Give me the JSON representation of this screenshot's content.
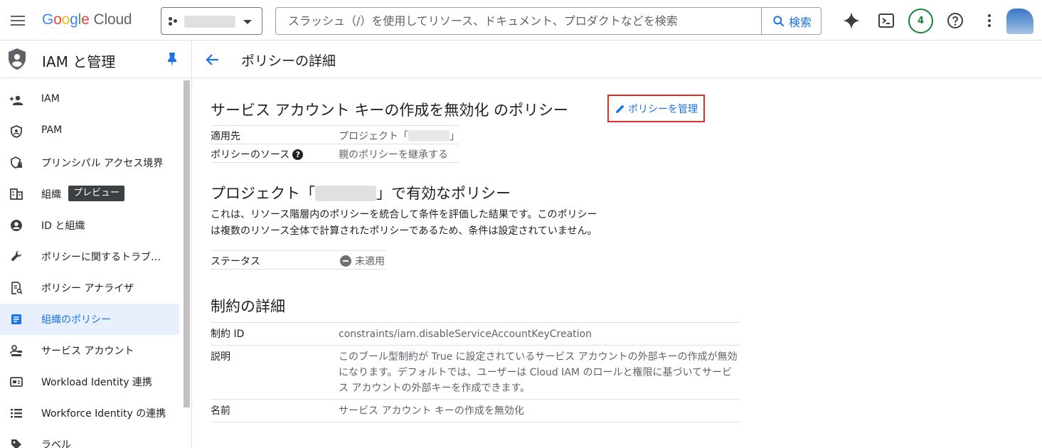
{
  "topbar": {
    "logo": {
      "google": "Google",
      "cloud": "Cloud"
    },
    "search_placeholder": "スラッシュ（/）を使用してリソース、ドキュメント、プロダクトなどを検索",
    "search_button": "検索",
    "notifications_count": "4",
    "icons": [
      "menu-icon",
      "project-icon",
      "search-icon",
      "gemini-sparkle-icon",
      "cloud-shell-icon",
      "help-icon",
      "more-vert-icon",
      "avatar"
    ]
  },
  "sidebar": {
    "title": "IAM と管理",
    "items": [
      {
        "label": "IAM",
        "icon": "person-add-icon"
      },
      {
        "label": "PAM",
        "icon": "shield-icon"
      },
      {
        "label": "プリンシパル アクセス境界",
        "icon": "lock-shield-icon"
      },
      {
        "label": "組織",
        "icon": "building-icon",
        "chip": "プレビュー"
      },
      {
        "label": "ID と組織",
        "icon": "account-circle-icon"
      },
      {
        "label": "ポリシーに関するトラブ…",
        "icon": "wrench-icon"
      },
      {
        "label": "ポリシー アナライザ",
        "icon": "analyzer-icon"
      },
      {
        "label": "組織のポリシー",
        "icon": "document-icon",
        "active": true
      },
      {
        "label": "サービス アカウント",
        "icon": "service-account-icon"
      },
      {
        "label": "Workload Identity 連携",
        "icon": "id-card-icon"
      },
      {
        "label": "Workforce Identity の連携",
        "icon": "list-icon"
      },
      {
        "label": "ラベル",
        "icon": "label-icon"
      }
    ]
  },
  "page": {
    "title": "ポリシーの詳細",
    "policy_title": "サービス アカウント キーの作成を無効化 のポリシー",
    "manage_button": "ポリシーを管理",
    "info": {
      "applies_to_label": "適用先",
      "applies_to_prefix": "プロジェクト「",
      "applies_to_suffix": "」",
      "source_label": "ポリシーのソース",
      "source_value": "親のポリシーを継承する"
    },
    "effective": {
      "heading_prefix": "プロジェクト「",
      "heading_suffix": "」で有効なポリシー",
      "desc_line1": "これは、リソース階層内のポリシーを統合して条件を評価した結果です。このポリシー",
      "desc_line2": "は複数のリソース全体で計算されたポリシーであるため、条件は設定されていません。",
      "status_label": "ステータス",
      "status_value": "未適用"
    },
    "constraint": {
      "heading": "制約の詳細",
      "rows": [
        {
          "label": "制約 ID",
          "value": "constraints/iam.disableServiceAccountKeyCreation"
        },
        {
          "label": "説明",
          "value": "このブール型制約が True に設定されているサービス アカウントの外部キーの作成が無効になります。デフォルトでは、ユーザーは Cloud IAM のロールと権限に基づいてサービス アカウントの外部キーを作成できます。"
        },
        {
          "label": "名前",
          "value": "サービス アカウント キーの作成を無効化"
        }
      ]
    }
  }
}
